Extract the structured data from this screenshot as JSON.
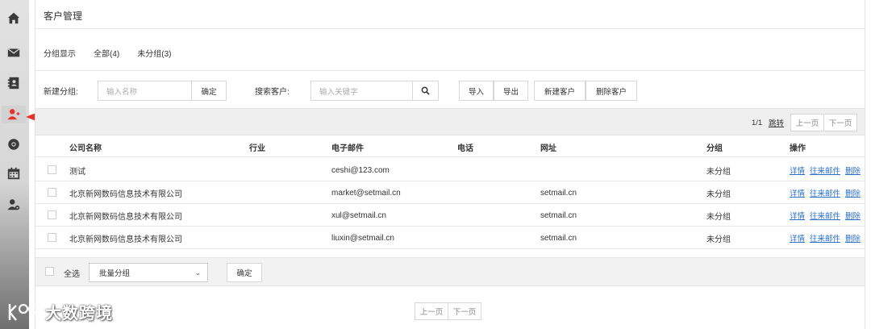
{
  "sidebar": {
    "icons": [
      {
        "name": "home-icon"
      },
      {
        "name": "mail-icon"
      },
      {
        "name": "contacts-icon"
      },
      {
        "name": "customer-icon",
        "active": true
      },
      {
        "name": "lifebuoy-icon"
      },
      {
        "name": "calendar-icon"
      },
      {
        "name": "user-settings-icon"
      }
    ],
    "accent": "#e8332a"
  },
  "page": {
    "title": "客户管理"
  },
  "groups": {
    "label": "分组显示",
    "all": "全部(4)",
    "ungrouped": "未分组(3)"
  },
  "toolbar": {
    "new_group_label": "新建分组:",
    "group_name_placeholder": "输入名称",
    "confirm": "确定",
    "search_label": "搜索客户:",
    "search_placeholder": "输入关键字",
    "import": "导入",
    "export": "导出",
    "new_customer": "新建客户",
    "delete_customer": "删除客户"
  },
  "pager_top": {
    "info": "1/1",
    "jump": "跳转",
    "prev": "上一页",
    "next": "下一页"
  },
  "table": {
    "headers": {
      "company": "公司名称",
      "industry": "行业",
      "email": "电子邮件",
      "phone": "电话",
      "website": "网址",
      "group": "分组",
      "actions": "操作"
    },
    "rows": [
      {
        "company": "测试",
        "industry": "",
        "email": "ceshi@123.com",
        "phone": "",
        "website": "",
        "group": "未分组"
      },
      {
        "company": "北京新网数码信息技术有限公司",
        "industry": "",
        "email": "market@setmail.cn",
        "phone": "",
        "website": "setmail.cn",
        "group": "未分组"
      },
      {
        "company": "北京新网数码信息技术有限公司",
        "industry": "",
        "email": "xul@setmail.cn",
        "phone": "",
        "website": "setmail.cn",
        "group": "未分组"
      },
      {
        "company": "北京新网数码信息技术有限公司",
        "industry": "",
        "email": "liuxin@setmail.cn",
        "phone": "",
        "website": "setmail.cn",
        "group": "未分组"
      }
    ],
    "row_actions": {
      "detail": "详情",
      "mails": "往来邮件",
      "delete": "删除"
    }
  },
  "footer": {
    "select_all": "全选",
    "batch_group": "批量分组",
    "confirm": "确定"
  },
  "pager_bottom": {
    "prev": "上一页",
    "next": "下一页"
  },
  "watermark": {
    "text": "大数跨境"
  }
}
